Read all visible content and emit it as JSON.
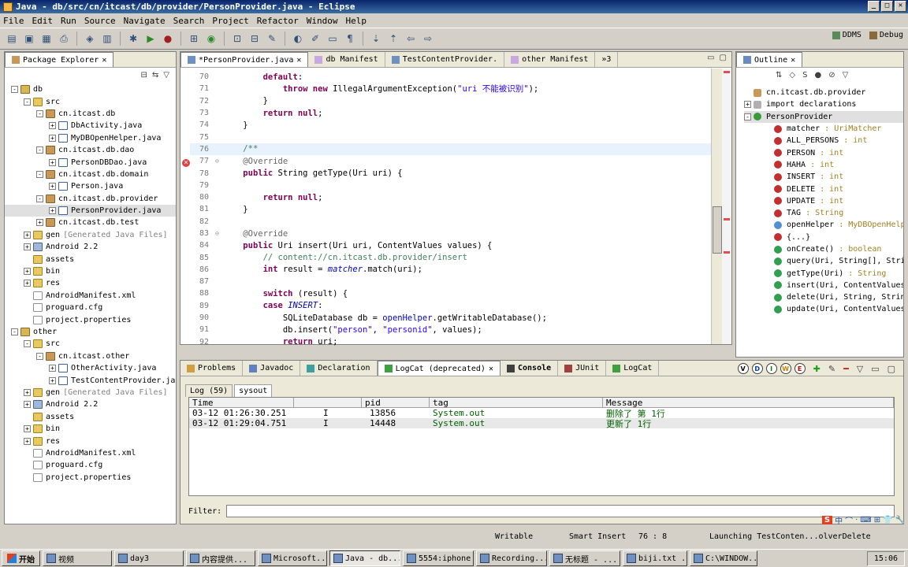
{
  "window": {
    "title": "Java - db/src/cn/itcast/db/provider/PersonProvider.java - Eclipse"
  },
  "menu": [
    "File",
    "Edit",
    "Run",
    "Source",
    "Navigate",
    "Search",
    "Project",
    "Refactor",
    "Window",
    "Help"
  ],
  "perspectives": [
    "DDMS",
    "Debug"
  ],
  "package_explorer": {
    "title": "Package Explorer",
    "tree": [
      {
        "indent": 0,
        "exp": "-",
        "icon": "project",
        "label": "db"
      },
      {
        "indent": 1,
        "exp": "-",
        "icon": "folder",
        "label": "src"
      },
      {
        "indent": 2,
        "exp": "-",
        "icon": "pkg",
        "label": "cn.itcast.db"
      },
      {
        "indent": 3,
        "exp": "+",
        "icon": "java",
        "label": "DbActivity.java"
      },
      {
        "indent": 3,
        "exp": "+",
        "icon": "java",
        "label": "MyDBOpenHelper.java"
      },
      {
        "indent": 2,
        "exp": "-",
        "icon": "pkg",
        "label": "cn.itcast.db.dao"
      },
      {
        "indent": 3,
        "exp": "+",
        "icon": "java",
        "label": "PersonDBDao.java"
      },
      {
        "indent": 2,
        "exp": "-",
        "icon": "pkg",
        "label": "cn.itcast.db.domain"
      },
      {
        "indent": 3,
        "exp": "+",
        "icon": "java",
        "label": "Person.java"
      },
      {
        "indent": 2,
        "exp": "-",
        "icon": "pkg",
        "label": "cn.itcast.db.provider"
      },
      {
        "indent": 3,
        "exp": "+",
        "icon": "java",
        "label": "PersonProvider.java"
      },
      {
        "indent": 2,
        "exp": "+",
        "icon": "pkg",
        "label": "cn.itcast.db.test"
      },
      {
        "indent": 1,
        "exp": "+",
        "icon": "folder",
        "label": "gen",
        "note": "[Generated Java Files]"
      },
      {
        "indent": 1,
        "exp": "+",
        "icon": "lib",
        "label": "Android 2.2"
      },
      {
        "indent": 1,
        "exp": "",
        "icon": "folder",
        "label": "assets"
      },
      {
        "indent": 1,
        "exp": "+",
        "icon": "folder",
        "label": "bin"
      },
      {
        "indent": 1,
        "exp": "+",
        "icon": "folder",
        "label": "res"
      },
      {
        "indent": 1,
        "exp": "",
        "icon": "file",
        "label": "AndroidManifest.xml"
      },
      {
        "indent": 1,
        "exp": "",
        "icon": "file",
        "label": "proguard.cfg"
      },
      {
        "indent": 1,
        "exp": "",
        "icon": "file",
        "label": "project.properties"
      },
      {
        "indent": 0,
        "exp": "-",
        "icon": "project",
        "label": "other"
      },
      {
        "indent": 1,
        "exp": "-",
        "icon": "folder",
        "label": "src"
      },
      {
        "indent": 2,
        "exp": "-",
        "icon": "pkg",
        "label": "cn.itcast.other"
      },
      {
        "indent": 3,
        "exp": "+",
        "icon": "java",
        "label": "OtherActivity.java"
      },
      {
        "indent": 3,
        "exp": "+",
        "icon": "java",
        "label": "TestContentProvider.jav"
      },
      {
        "indent": 1,
        "exp": "+",
        "icon": "folder",
        "label": "gen",
        "note": "[Generated Java Files]"
      },
      {
        "indent": 1,
        "exp": "+",
        "icon": "lib",
        "label": "Android 2.2"
      },
      {
        "indent": 1,
        "exp": "",
        "icon": "folder",
        "label": "assets"
      },
      {
        "indent": 1,
        "exp": "+",
        "icon": "folder",
        "label": "bin"
      },
      {
        "indent": 1,
        "exp": "+",
        "icon": "folder",
        "label": "res"
      },
      {
        "indent": 1,
        "exp": "",
        "icon": "file",
        "label": "AndroidManifest.xml"
      },
      {
        "indent": 1,
        "exp": "",
        "icon": "file",
        "label": "proguard.cfg"
      },
      {
        "indent": 1,
        "exp": "",
        "icon": "file",
        "label": "project.properties"
      }
    ]
  },
  "editor": {
    "tabs": [
      "*PersonProvider.java",
      "db Manifest",
      "TestContentProvider.",
      "other Manifest"
    ],
    "tab_overflow": "»3",
    "lines": [
      {
        "n": "70",
        "html": "        <span class=\"kw\">default</span>:"
      },
      {
        "n": "71",
        "html": "            <span class=\"kw\">throw</span> <span class=\"kw\">new</span> IllegalArgumentException(<span class=\"str\">\"uri 不能被识别\"</span>);"
      },
      {
        "n": "72",
        "html": "        }"
      },
      {
        "n": "73",
        "html": "        <span class=\"kw\">return</span> <span class=\"kw\">null</span>;"
      },
      {
        "n": "74",
        "html": "    }"
      },
      {
        "n": "75",
        "html": ""
      },
      {
        "n": "76",
        "html": "    <span class=\"cmt\">/**</span>",
        "cur": true
      },
      {
        "n": "77",
        "html": "    <span class=\"ann\">@Override</span>",
        "fold": "⊖"
      },
      {
        "n": "78",
        "html": "    <span class=\"kw\">public</span> String getType(Uri uri) {"
      },
      {
        "n": "79",
        "html": ""
      },
      {
        "n": "80",
        "html": "        <span class=\"kw\">return</span> <span class=\"kw\">null</span>;"
      },
      {
        "n": "81",
        "html": "    }"
      },
      {
        "n": "82",
        "html": ""
      },
      {
        "n": "83",
        "html": "    <span class=\"ann\">@Override</span>",
        "fold": "⊖"
      },
      {
        "n": "84",
        "html": "    <span class=\"kw\">public</span> Uri insert(Uri uri, ContentValues values) {"
      },
      {
        "n": "85",
        "html": "        <span class=\"cmt\">// content://cn.itcast.db.provider/insert</span>"
      },
      {
        "n": "86",
        "html": "        <span class=\"kw\">int</span> result = <span class=\"fld ital\">matcher</span>.match(uri);"
      },
      {
        "n": "87",
        "html": ""
      },
      {
        "n": "88",
        "html": "        <span class=\"kw\">switch</span> (result) {"
      },
      {
        "n": "89",
        "html": "        <span class=\"kw\">case</span> <span class=\"fld ital\">INSERT</span>:"
      },
      {
        "n": "90",
        "html": "            SQLiteDatabase db = <span class=\"fld\">openHelper</span>.getWritableDatabase();"
      },
      {
        "n": "91",
        "html": "            db.insert(<span class=\"str\">\"person\"</span>, <span class=\"str\">\"personid\"</span>, values);"
      },
      {
        "n": "92",
        "html": "            <span class=\"kw\">return</span> uri;"
      }
    ]
  },
  "outline": {
    "title": "Outline",
    "items": [
      {
        "indent": 0,
        "icon": "pkg",
        "label": "cn.itcast.db.provider",
        "type": ""
      },
      {
        "indent": 0,
        "exp": "+",
        "icon": "imports",
        "label": "import declarations",
        "type": ""
      },
      {
        "indent": 0,
        "exp": "-",
        "icon": "class",
        "label": "PersonProvider",
        "type": ""
      },
      {
        "indent": 1,
        "icon": "sf",
        "label": "matcher",
        "type": ": UriMatcher"
      },
      {
        "indent": 1,
        "icon": "sf",
        "label": "ALL_PERSONS",
        "type": ": int"
      },
      {
        "indent": 1,
        "icon": "sf",
        "label": "PERSON",
        "type": ": int"
      },
      {
        "indent": 1,
        "icon": "sf",
        "label": "HAHA",
        "type": ": int"
      },
      {
        "indent": 1,
        "icon": "sf",
        "label": "INSERT",
        "type": ": int"
      },
      {
        "indent": 1,
        "icon": "sf",
        "label": "DELETE",
        "type": ": int"
      },
      {
        "indent": 1,
        "icon": "sf",
        "label": "UPDATE",
        "type": ": int"
      },
      {
        "indent": 1,
        "icon": "sf",
        "label": "TAG",
        "type": ": String"
      },
      {
        "indent": 1,
        "icon": "field",
        "label": "openHelper",
        "type": ": MyDBOpenHelpe"
      },
      {
        "indent": 1,
        "icon": "static",
        "label": "{...}",
        "type": ""
      },
      {
        "indent": 1,
        "icon": "method",
        "label": "onCreate()",
        "type": ": boolean"
      },
      {
        "indent": 1,
        "icon": "method",
        "label": "query(Uri, String[], Strin",
        "type": ""
      },
      {
        "indent": 1,
        "icon": "method",
        "label": "getType(Uri)",
        "type": ": String"
      },
      {
        "indent": 1,
        "icon": "method",
        "label": "insert(Uri, ContentValues)",
        "type": ""
      },
      {
        "indent": 1,
        "icon": "method",
        "label": "delete(Uri, String, String",
        "type": ""
      },
      {
        "indent": 1,
        "icon": "method",
        "label": "update(Uri, ContentValues,",
        "type": ""
      }
    ]
  },
  "bottom": {
    "tabs": [
      "Problems",
      "Javadoc",
      "Declaration",
      "LogCat (deprecated)",
      "Console",
      "JUnit",
      "LogCat"
    ],
    "log_filters": [
      "Log (59)",
      "sysout"
    ],
    "columns": [
      "Time",
      "",
      "pid",
      "tag",
      "Message"
    ],
    "rows": [
      {
        "time": "03-12 01:26:30.251",
        "level": "I",
        "pid": "13856",
        "tag": "System.out",
        "message": "删除了 第 1行"
      },
      {
        "time": "03-12 01:29:04.751",
        "level": "I",
        "pid": "14448",
        "tag": "System.out",
        "message": "更新了 1行"
      }
    ],
    "level_buttons": [
      "V",
      "D",
      "I",
      "W",
      "E"
    ],
    "filter_label": "Filter:"
  },
  "status": {
    "writable": "Writable",
    "insert_mode": "Smart Insert",
    "position": "76 : 8",
    "job": "Launching TestConten...olverDelete"
  },
  "ime": [
    "中",
    "⌒",
    "·",
    "⌨",
    "⊞",
    "👕",
    "🔧"
  ],
  "taskbar": {
    "start": "开始",
    "tasks": [
      "视频",
      "day3",
      "内容提供...",
      "Microsoft...",
      "Java - db...",
      "5554:iphone",
      "Recording...",
      "无标题 - ...",
      "biji.txt ...",
      "C:\\WINDOW..."
    ],
    "active_index": 4,
    "clock": "15:06"
  },
  "colors": {
    "keyword": "#7f0055",
    "string": "#2a00ff",
    "comment": "#3f7f5f",
    "field": "#0000c0",
    "title_bar": "#0a246a"
  }
}
